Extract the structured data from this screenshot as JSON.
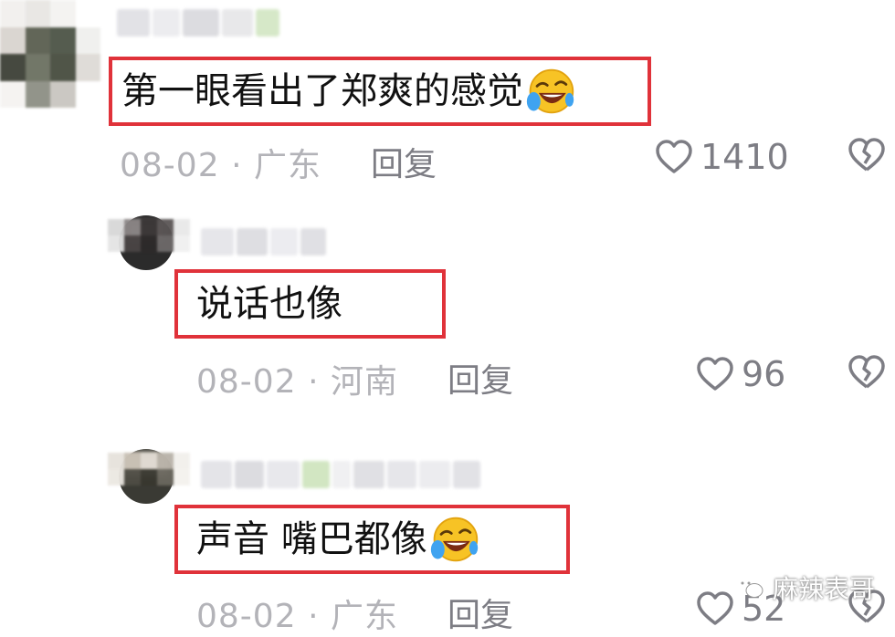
{
  "comments": [
    {
      "text": "第一眼看出了郑爽的感觉",
      "emoji": "laughing-crying-emoji",
      "date": "08-02",
      "region": "广东",
      "reply_label": "回复",
      "likes": "1410"
    },
    {
      "text": "说话也像",
      "date": "08-02",
      "region": "河南",
      "reply_label": "回复",
      "likes": "96"
    },
    {
      "text": "声音 嘴巴都像",
      "emoji": "laughing-crying-emoji",
      "date": "08-02",
      "region": "广东",
      "reply_label": "回复",
      "likes": "52"
    }
  ],
  "separator": "·",
  "watermark": {
    "text": "麻辣表哥"
  },
  "colors": {
    "highlight_border": "#e0323a",
    "meta_text": "#b3b3b8",
    "secondary_text": "#7d7d84"
  }
}
